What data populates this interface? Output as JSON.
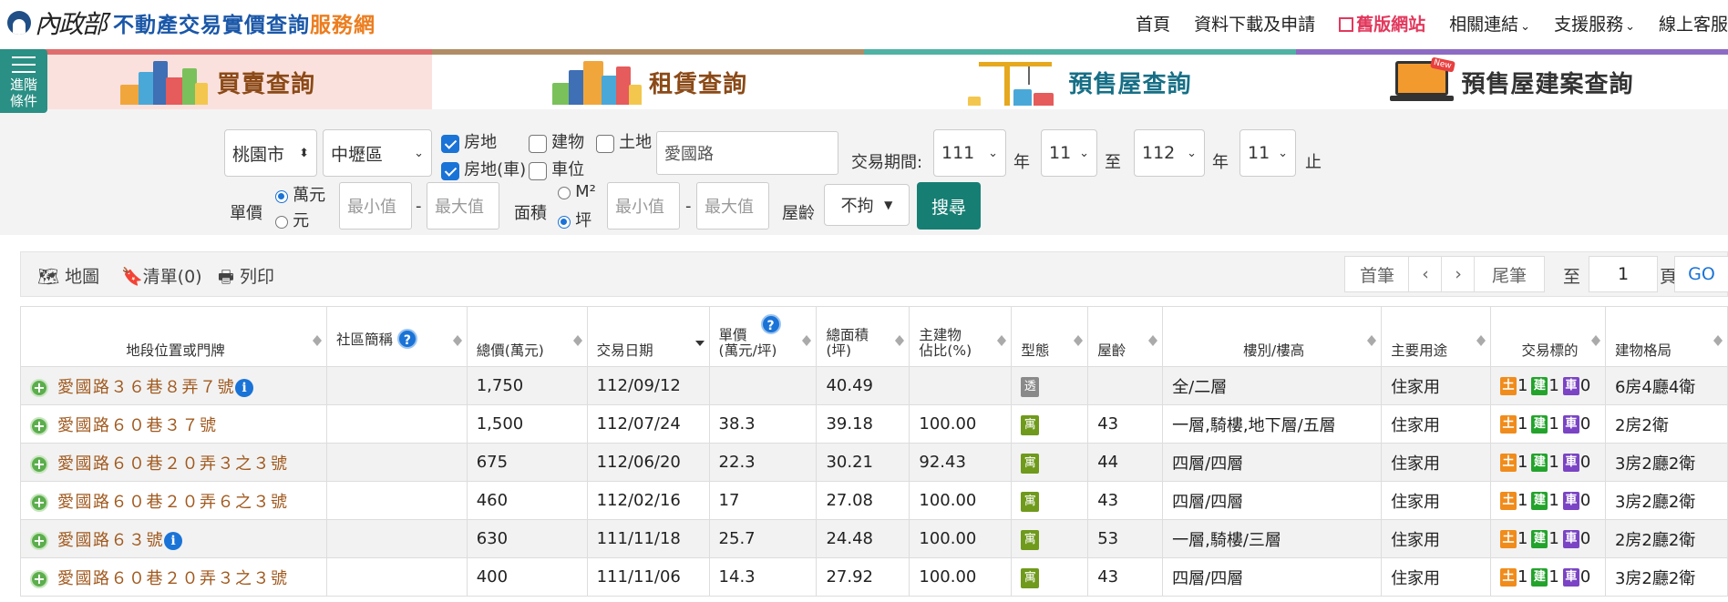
{
  "header": {
    "logo_ministry": "內政部",
    "logo_title": "不動產交易實價查詢",
    "logo_title_accent": "服務網",
    "nav": [
      {
        "label": "首頁"
      },
      {
        "label": "資料下載及申請"
      },
      {
        "label": "舊版網站"
      },
      {
        "label": "相關連結"
      },
      {
        "label": "支援服務"
      },
      {
        "label": "線上客服"
      }
    ]
  },
  "sidebar_button": {
    "label_line1": "進階",
    "label_line2": "條件"
  },
  "tabs": [
    {
      "label": "買賣查詢",
      "icon": "city-sale-icon"
    },
    {
      "label": "租賃查詢",
      "icon": "city-rent-icon"
    },
    {
      "label": "預售屋查詢",
      "icon": "crane-icon"
    },
    {
      "label": "預售屋建案查詢",
      "icon": "laptop-new-icon",
      "badge": "New"
    }
  ],
  "search": {
    "city": "桃園市",
    "district": "中壢區",
    "types": [
      {
        "label": "房地",
        "checked": true
      },
      {
        "label": "建物",
        "checked": false
      },
      {
        "label": "土地",
        "checked": false
      },
      {
        "label": "房地(車)",
        "checked": true
      },
      {
        "label": "車位",
        "checked": false
      }
    ],
    "road": "愛國路",
    "period_label": "交易期間:",
    "start_year": "111",
    "year_unit": "年",
    "start_month": "11",
    "to_label": "至",
    "end_year": "112",
    "end_month": "11",
    "end_label": "止",
    "unit_price_label": "單價",
    "unit_options": [
      "萬元",
      "元"
    ],
    "min_placeholder": "最小值",
    "max_placeholder": "最大值",
    "dash": "-",
    "area_label": "面積",
    "area_options": [
      "M²",
      "坪"
    ],
    "age_label": "屋齡",
    "age_value": "不拘",
    "search_button": "搜尋"
  },
  "toolbar": {
    "map": "地圖",
    "list": "清單(0)",
    "print": "列印",
    "first": "首筆",
    "prev": "‹",
    "next": "›",
    "last": "尾筆",
    "goto_label": "至",
    "page": "1",
    "page_unit": "頁",
    "go": "GO"
  },
  "table": {
    "columns": [
      "地段位置或門牌",
      "社區簡稱",
      "總價(萬元)",
      "交易日期",
      "單價\n(萬元/坪)",
      "總面積\n(坪)",
      "主建物\n佔比(%)",
      "型態",
      "屋齡",
      "樓別/樓高",
      "主要用途",
      "交易標的",
      "建物格局"
    ],
    "rows": [
      {
        "addr": "愛國路３６巷８弄７號",
        "info": true,
        "community": "",
        "price": "1,750",
        "date": "112/09/12",
        "unit": "",
        "area": "40.49",
        "ratio": "",
        "type": "透",
        "age": "",
        "floor": "全/二層",
        "use": "住家用",
        "land": "1",
        "bldg": "1",
        "park": "0",
        "layout": "6房4廳4衛"
      },
      {
        "addr": "愛國路６０巷３７號",
        "info": false,
        "community": "",
        "price": "1,500",
        "date": "112/07/24",
        "unit": "38.3",
        "area": "39.18",
        "ratio": "100.00",
        "type": "寓",
        "age": "43",
        "floor": "一層,騎樓,地下層/五層",
        "use": "住家用",
        "land": "1",
        "bldg": "1",
        "park": "0",
        "layout": "2房2衛"
      },
      {
        "addr": "愛國路６０巷２０弄３之３號",
        "info": false,
        "community": "",
        "price": "675",
        "date": "112/06/20",
        "unit": "22.3",
        "area": "30.21",
        "ratio": "92.43",
        "type": "寓",
        "age": "44",
        "floor": "四層/四層",
        "use": "住家用",
        "land": "1",
        "bldg": "1",
        "park": "0",
        "layout": "3房2廳2衛"
      },
      {
        "addr": "愛國路６０巷２０弄６之３號",
        "info": false,
        "community": "",
        "price": "460",
        "date": "112/02/16",
        "unit": "17",
        "area": "27.08",
        "ratio": "100.00",
        "type": "寓",
        "age": "43",
        "floor": "四層/四層",
        "use": "住家用",
        "land": "1",
        "bldg": "1",
        "park": "0",
        "layout": "3房2廳2衛"
      },
      {
        "addr": "愛國路６３號",
        "info": true,
        "community": "",
        "price": "630",
        "date": "111/11/18",
        "unit": "25.7",
        "area": "24.48",
        "ratio": "100.00",
        "type": "寓",
        "age": "53",
        "floor": "一層,騎樓/三層",
        "use": "住家用",
        "land": "1",
        "bldg": "1",
        "park": "0",
        "layout": "2房2廳2衛"
      },
      {
        "addr": "愛國路６０巷２０弄３之３號",
        "info": false,
        "community": "",
        "price": "400",
        "date": "111/11/06",
        "unit": "14.3",
        "area": "27.92",
        "ratio": "100.00",
        "type": "寓",
        "age": "43",
        "floor": "四層/四層",
        "use": "住家用",
        "land": "1",
        "bldg": "1",
        "park": "0",
        "layout": "3房2廳2衛"
      }
    ],
    "target_labels": {
      "land": "土",
      "bldg": "建",
      "park": "車"
    }
  },
  "colors": {
    "accent": "#1a73d6",
    "search_btn": "#177e73",
    "addr": "#a15a1f",
    "type_transparent": "#8a8a8a",
    "type_apartment": "#6f9a1c"
  }
}
